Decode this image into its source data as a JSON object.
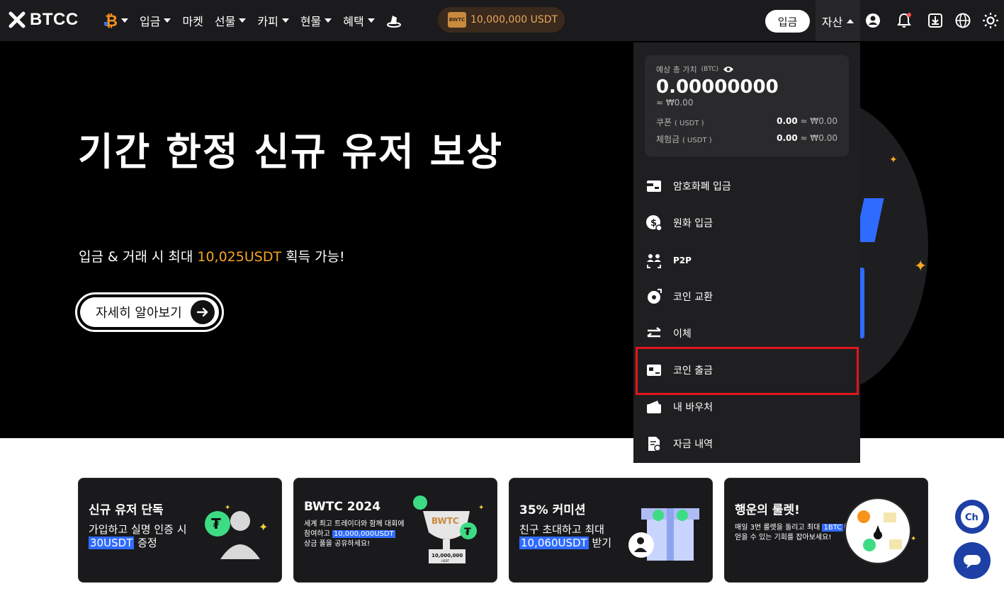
{
  "header": {
    "logo_text": "BTCC",
    "nav": [
      {
        "label": "입금"
      },
      {
        "label": "마켓"
      },
      {
        "label": "선물"
      },
      {
        "label": "카피"
      },
      {
        "label": "현물"
      },
      {
        "label": "혜택"
      }
    ],
    "promo_badge": "BWTC",
    "promo_text": "10,000,000 USDT",
    "deposit_button": "입금",
    "assets_tab": "자산"
  },
  "hero": {
    "title": "기간 한정 신규 유저 보상",
    "subtitle_pre": "입금 & 거래 시 최대 ",
    "subtitle_highlight": "10,025USDT",
    "subtitle_post": " 획득 가능!",
    "cta_label": "자세히 알아보기"
  },
  "assets_dropdown": {
    "balance_label": "예상 총 가치",
    "balance_unit": "(BTC)",
    "balance_value": "0.00000000",
    "balance_approx": "≈ ₩0.00",
    "rows": [
      {
        "label": "쿠폰",
        "unit": "( USDT )",
        "value": "0.00",
        "approx": "≈ ₩0.00"
      },
      {
        "label": "체험금",
        "unit": "( USDT )",
        "value": "0.00",
        "approx": "≈ ₩0.00"
      }
    ],
    "items": [
      {
        "label": "암호화폐 입금",
        "icon": "crypto-deposit-icon"
      },
      {
        "label": "원화 입금",
        "icon": "krw-deposit-icon"
      },
      {
        "label": "P2P",
        "icon": "p2p-icon"
      },
      {
        "label": "코인 교환",
        "icon": "coin-exchange-icon"
      },
      {
        "label": "이체",
        "icon": "transfer-icon"
      },
      {
        "label": "코인 출금",
        "icon": "coin-withdraw-icon"
      },
      {
        "label": "내 바우처",
        "icon": "voucher-icon"
      },
      {
        "label": "자금 내역",
        "icon": "fund-history-icon"
      }
    ]
  },
  "cards": [
    {
      "title": "신규 유저 단독",
      "line1": "가입하고 실명 인증 시",
      "highlight": "30USDT",
      "line2_post": " 증정"
    },
    {
      "title": "BWTC 2024",
      "line1": "세계 최고 트레이더와 함께 대회에",
      "line2_pre": "참여하고 ",
      "highlight": "10,000,000USDT",
      "line3": "상금 풀을 공유하세요!",
      "trophy_label": "BWTC",
      "trophy_amount": "10,000,000",
      "trophy_unit": "USDT"
    },
    {
      "title": "35% 커미션",
      "line1": "친구 초대하고 최대",
      "highlight": "10,060USDT",
      "line2_post": " 받기"
    },
    {
      "title": "행운의 룰렛!",
      "line1_pre": "매일 3번 룰렛을 돌리고 최대 ",
      "highlight": "1BTC",
      "line1_post": "를",
      "line2": "얻을 수 있는 기회를 잡아보세요!"
    }
  ],
  "chat_widget": {
    "badge": "Ch"
  },
  "colors": {
    "accent": "#f5a623",
    "brand_blue": "#2f6bff",
    "highlight_red": "#e0161d",
    "usdt_green": "#3ddc84"
  }
}
